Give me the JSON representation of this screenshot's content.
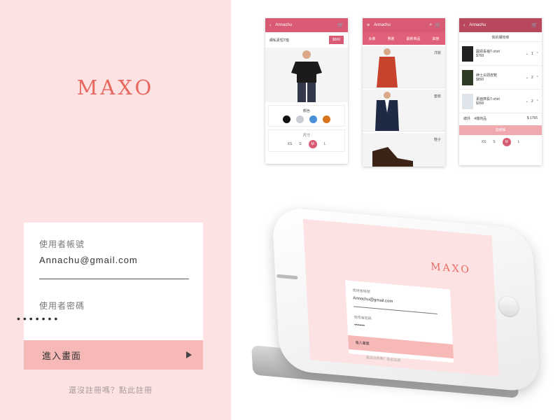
{
  "login": {
    "brand": "MAXO",
    "username_label": "使用者帳號",
    "username_value": "Annachu@gmail.com",
    "password_label": "使用者密碼",
    "password_dots": "•••••••",
    "enter_button": "進入畫面",
    "register_link": "還沒註冊嗎？點此註冊"
  },
  "screens": {
    "product": {
      "header": "Annachu",
      "product_title": "網私素短T恤",
      "price": "$500",
      "color_label": "顏色",
      "size_label": "尺寸",
      "sizes": [
        "XS",
        "S",
        "M",
        "L"
      ],
      "selected_size": "M"
    },
    "catalog": {
      "header": "Annachu",
      "tabs": [
        "女裝",
        "男裝",
        "最新商品",
        "其他"
      ],
      "products": [
        "洋裝",
        "套裝",
        "鞋子"
      ]
    },
    "cart": {
      "header": "Annachu",
      "subtitle": "我的購物車",
      "items": [
        {
          "name": "圓領長袖T-shirt",
          "price": "$768",
          "qty": "1"
        },
        {
          "name": "紳士尖頭皮鞋",
          "price": "$899",
          "qty": "2"
        },
        {
          "name": "素面擠長T-shirt",
          "price": "$398",
          "qty": "2"
        }
      ],
      "total_label": "總共",
      "item_count": "4樣商品",
      "total_value": "$ 1766",
      "checkout": "去結帳",
      "sizes": [
        "XS",
        "S",
        "M",
        "L"
      ],
      "selected_size": "M"
    }
  },
  "mockup": {
    "brand": "MAXO",
    "username_label": "使用者帳號",
    "username_value": "Annachu@gmail.com",
    "password_label": "使用者密碼",
    "password_dots": "•••••••",
    "enter_button": "進入畫面",
    "register_link": "還沒註冊嗎？點此註冊"
  },
  "colors": {
    "panel_bg": "#fde2e3",
    "brand": "#e8675e",
    "accent": "#d85a73",
    "button": "#f7b8b8",
    "swatches": [
      "#111111",
      "#c9ccd3",
      "#4a90d9",
      "#d9731e"
    ]
  }
}
